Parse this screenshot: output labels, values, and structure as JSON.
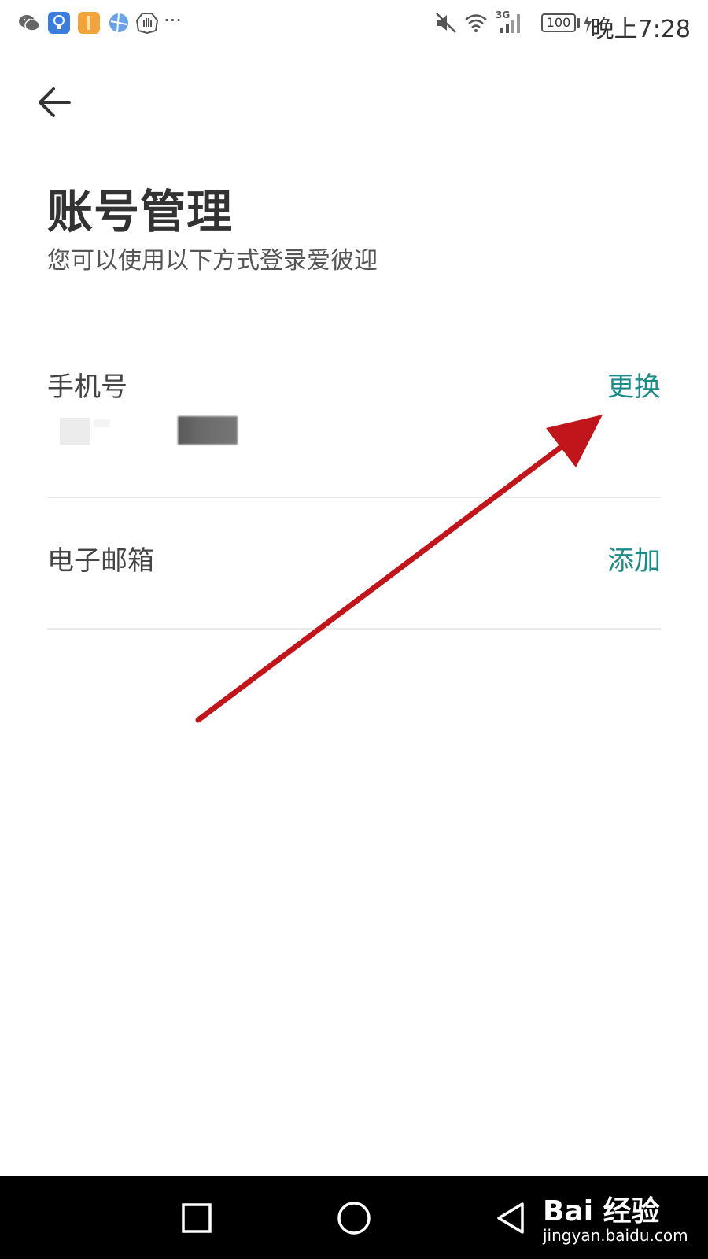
{
  "status_bar": {
    "time": "晚上7:28",
    "battery": "100",
    "network": "3G",
    "more_indicator": "···",
    "icons": [
      "wechat-icon",
      "lightbulb-app-icon",
      "orange-app-icon",
      "browser-icon",
      "hand-stop-icon",
      "mute-icon",
      "wifi-icon",
      "signal-icon",
      "battery-icon",
      "charging-icon"
    ]
  },
  "header": {
    "back_icon": "arrow-left-icon",
    "title": "账号管理",
    "subtitle": "您可以使用以下方式登录爱彼迎"
  },
  "account": {
    "phone": {
      "label": "手机号",
      "action": "更换"
    },
    "email": {
      "label": "电子邮箱",
      "action": "添加"
    }
  },
  "annotation": {
    "arrow_color": "#c0161b"
  },
  "nav_bar": {
    "buttons": [
      "recents-square-icon",
      "home-circle-icon",
      "back-triangle-icon"
    ]
  },
  "watermark": {
    "brand": "Bai 经验",
    "url": "jingyan.baidu.com"
  },
  "colors": {
    "accent": "#1d8b88",
    "text": "#333333",
    "divider": "#e9e9e9"
  }
}
